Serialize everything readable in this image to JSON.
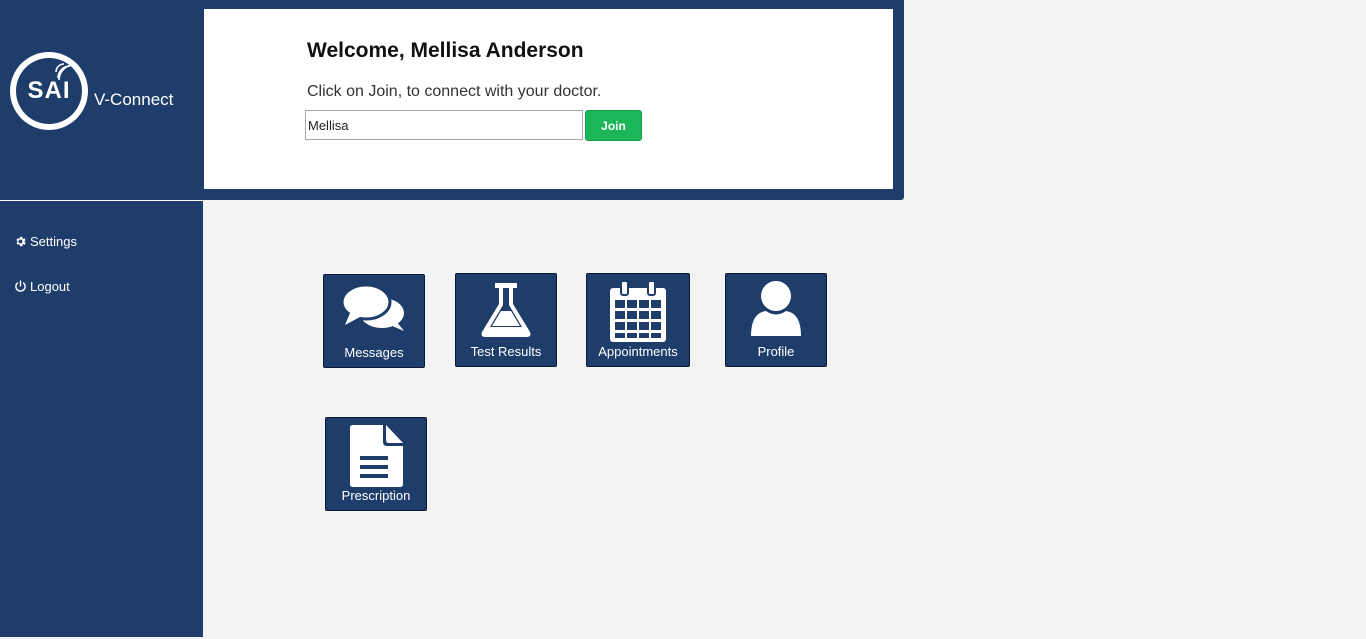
{
  "brand": {
    "logo_text": "SAI",
    "app_name": "V-Connect"
  },
  "nav": [
    {
      "label": "Settings",
      "icon": "gear-icon"
    },
    {
      "label": "Logout",
      "icon": "power-icon"
    }
  ],
  "welcome": {
    "title": "Welcome, Mellisa Anderson",
    "subtitle": "Click on Join, to connect with your doctor.",
    "name_value": "Mellisa",
    "join_label": "Join"
  },
  "tiles": [
    {
      "label": "Messages",
      "icon": "chat-bubbles-icon"
    },
    {
      "label": "Test Results",
      "icon": "flask-icon"
    },
    {
      "label": "Appointments",
      "icon": "calendar-icon"
    },
    {
      "label": "Profile",
      "icon": "user-icon"
    },
    {
      "label": "Prescription",
      "icon": "document-icon"
    }
  ],
  "colors": {
    "navy": "#1f3d6b",
    "join_green": "#1cb558",
    "background": "#f2f3f3"
  }
}
